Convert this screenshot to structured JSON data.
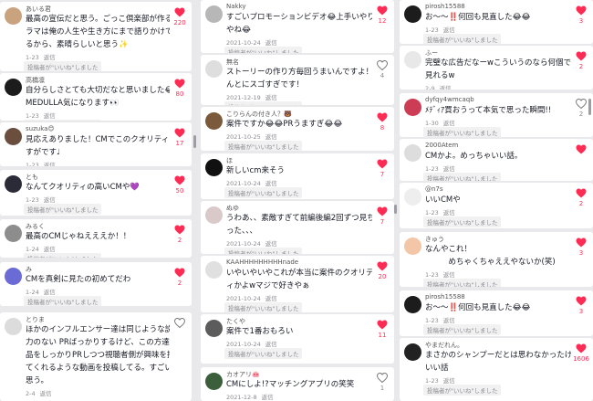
{
  "labels": {
    "reply": "返信",
    "liked_by_creator": "投稿者が\"いいね\"しました"
  },
  "colors": {
    "accent": "#fe2c55",
    "muted": "#8a8b91",
    "background": "#e9e9ec"
  },
  "comments": [
    {
      "username": "あいる君",
      "lines": [
        "最高の宣伝だと思う。ごっこ倶楽部が作るド",
        "ラマは俺の人生や生き方にまで語りかけてく",
        "るから、素晴らしいと思う✨"
      ],
      "date": "1-23",
      "liked_by_creator": true,
      "likes": "220",
      "liked": true
    },
    {
      "username": "高橋凛",
      "lines": [
        "自分らしさとても大切だなと思いました😂",
        "MEDULLA気になります👀"
      ],
      "date": "1-23",
      "liked_by_creator": true,
      "likes": "80",
      "liked": true
    },
    {
      "username": "suzuka😊",
      "lines": [
        "見応えありました！CMでこのクオリティはさ",
        "すがです♩"
      ],
      "date": "1-23",
      "liked_by_creator": true,
      "likes": "17",
      "liked": true
    },
    {
      "username": "とも",
      "lines": [
        "なんてクオリティの高いCMや💜"
      ],
      "date": "1-23",
      "liked_by_creator": true,
      "likes": "50",
      "liked": true
    },
    {
      "username": "みるく",
      "lines": [
        "最高のCMじゃねえええか！！"
      ],
      "date": "1-24",
      "liked_by_creator": true,
      "likes": "2",
      "liked": true
    },
    {
      "username": "み",
      "lines": [
        "CMを真剣に見たの初めてだわ"
      ],
      "date": "1-24",
      "liked_by_creator": true,
      "likes": "2",
      "liked": true
    },
    {
      "username": "とりま",
      "lines": [
        "ほかのインフルエンサー達は同じような説得",
        "力のない PRばっかりするけど、この方達は商",
        "品をしっかりPRしつつ視聴者側が興味を持っ",
        "てくれるような動画を投稿してる。すごいと",
        "思う。"
      ],
      "date": "2-4",
      "liked_by_creator": false,
      "likes": "",
      "liked": false
    },
    {
      "username": "Nakky",
      "lines": [
        "すごいプロモーションビデオ😂上手いやり方",
        "やね😂"
      ],
      "date": "2021-10-24",
      "liked_by_creator": true,
      "likes": "12",
      "liked": true
    },
    {
      "username": "無名",
      "lines": [
        "ストーリーの作り方毎回うまいんですよ！ほ",
        "んとにスゴすぎです！"
      ],
      "date": "2021-12-19",
      "liked_by_creator": true,
      "likes": "4",
      "liked": false
    },
    {
      "username": "こりらんの付き人？🐻",
      "lines": [
        "案件ですか😂😂PRうますぎ😂😂"
      ],
      "date": "2021-10-25",
      "liked_by_creator": true,
      "likes": "8",
      "liked": true
    },
    {
      "username": "ほ",
      "lines": [
        "新しいcm来そう"
      ],
      "date": "2021-10-24",
      "liked_by_creator": true,
      "likes": "7",
      "liked": true
    },
    {
      "username": "ぬゆ",
      "lines": [
        "うわあ、、素敵すぎて前編後編2回ずつ見ちゃ",
        "った、、、"
      ],
      "date": "2021-10-24",
      "liked_by_creator": true,
      "likes": "7",
      "liked": true
    },
    {
      "username": "KAAHHHHHHHHHnade",
      "lines": [
        "いやいやいやこれが本当に案件のクオリテ",
        "ィかよwマジで好きやぁ"
      ],
      "date": "2021-10-24",
      "liked_by_creator": true,
      "likes": "20",
      "liked": true
    },
    {
      "username": "たくや",
      "lines": [
        "案件で1番おもろい"
      ],
      "date": "2021-10-24",
      "liked_by_creator": true,
      "likes": "11",
      "liked": true
    },
    {
      "username": "カオアリ🐽",
      "lines": [
        "CMにしよ!?マッチングアプリの笑笑"
      ],
      "date": "2021-12-8",
      "liked_by_creator": true,
      "likes": "1",
      "liked": false
    },
    {
      "username": "pirosh15588",
      "lines": [
        "お〜〜‼️何回も見直した😂😂"
      ],
      "date": "1-23",
      "liked_by_creator": true,
      "likes": "3",
      "liked": true
    },
    {
      "username": "ふー",
      "lines": [
        "完璧な広告だなーwこういうのなら何個でも",
        "見れるw"
      ],
      "date": "2-9",
      "liked_by_creator": true,
      "likes": "2",
      "liked": true
    },
    {
      "username": "dyfqy4wmcaqb",
      "lines": [
        "ﾒﾃﾞｨｱ買おうって本気で思った瞬間!!"
      ],
      "date": "1-30",
      "liked_by_creator": true,
      "likes": "2",
      "liked": false
    },
    {
      "username": "2000Atem",
      "lines": [
        "CMかよ。めっちゃいい話。"
      ],
      "date": "1-23",
      "liked_by_creator": true,
      "likes": "",
      "liked": true
    },
    {
      "username": "@n7s",
      "lines": [
        "いいCMや"
      ],
      "date": "1-23",
      "liked_by_creator": true,
      "likes": "2",
      "liked": true
    },
    {
      "username": "きゅう",
      "lines": [
        "なんやこれ！",
        "　　　めちゃくちゃええやないか(笑)"
      ],
      "date": "1-23",
      "liked_by_creator": true,
      "likes": "3",
      "liked": true
    },
    {
      "username": "pirosh15588",
      "lines": [
        "お〜〜‼️何回も見直した😂😂"
      ],
      "date": "1-23",
      "liked_by_creator": true,
      "likes": "3",
      "liked": true
    },
    {
      "username": "やまだれん。",
      "lines": [
        "まさかのシャンプーだとは思わなかったけどい",
        "いい話"
      ],
      "date": "1-23",
      "liked_by_creator": true,
      "likes": "1606",
      "liked": true
    }
  ]
}
